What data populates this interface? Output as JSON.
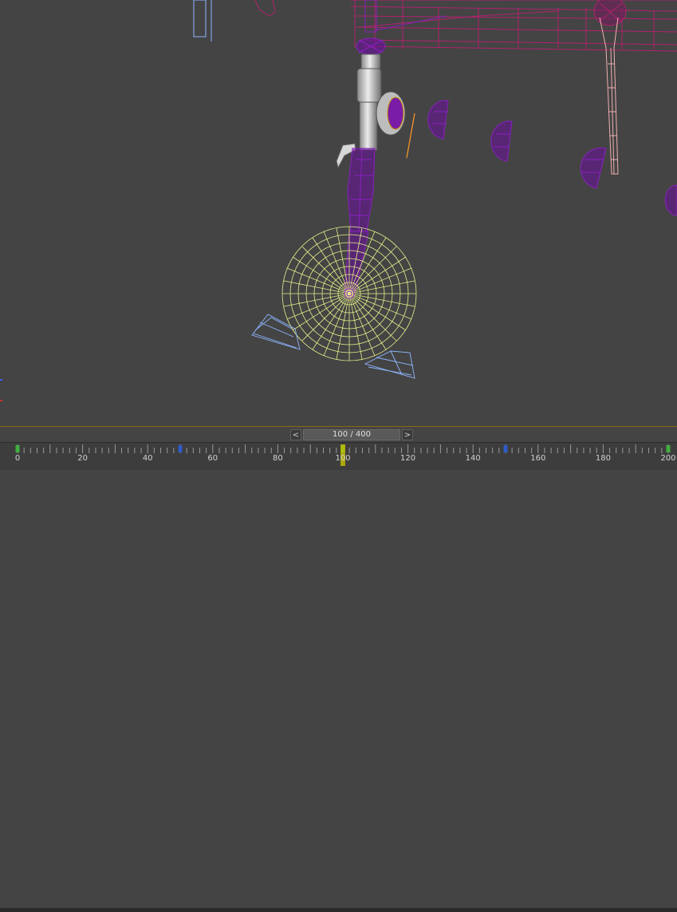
{
  "timeslider": {
    "prev_label": "<",
    "next_label": ">",
    "frame_display": "100 / 400",
    "current_frame": 100,
    "total_frames": 400
  },
  "ruler": {
    "labels": [
      "0",
      "20",
      "40",
      "60",
      "80",
      "100",
      "120",
      "140",
      "160",
      "180",
      "200"
    ],
    "range": [
      0,
      200
    ],
    "keyframes": [
      0,
      50,
      100,
      150,
      200
    ]
  },
  "colors": {
    "viewport_bg": "#444444",
    "wheel_wire": "#e6ee8a",
    "strut_wire": "#8b1fbf",
    "frame_wire": "#b0226e",
    "pylon_wire": "#f0b0b0",
    "skid_wire": "#8fb6ff",
    "timebar_border": "#8a6a1a",
    "key_green": "#3fae3f",
    "key_blue": "#2f59c9",
    "current_frame": "#c8c000"
  }
}
